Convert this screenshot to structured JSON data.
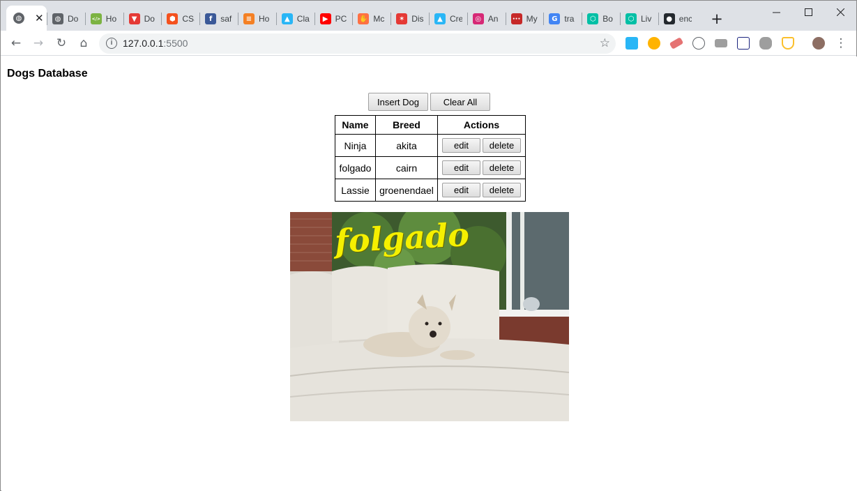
{
  "browser": {
    "tabs": [
      {
        "title": "Do",
        "favicon": "globe-icon",
        "color": "#5f6368"
      },
      {
        "title": "Ho",
        "favicon": "code-icon",
        "color": "#7cb342"
      },
      {
        "title": "Do",
        "favicon": "gitlab-like-icon",
        "color": "#e53935"
      },
      {
        "title": "CSS",
        "favicon": "css-shield-icon",
        "color": "#f4511e"
      },
      {
        "title": "saf",
        "favicon": "facebook-icon",
        "color": "#3b5998"
      },
      {
        "title": "Ho",
        "favicon": "stackoverflow-icon",
        "color": "#f48024"
      },
      {
        "title": "Cla",
        "favicon": "graduation-cap-icon",
        "color": "#29b6f6"
      },
      {
        "title": "PC",
        "favicon": "youtube-icon",
        "color": "#ff0000"
      },
      {
        "title": "Mc",
        "favicon": "hand-icon",
        "color": "#ff7043"
      },
      {
        "title": "Dis",
        "favicon": "figure-icon",
        "color": "#e53935"
      },
      {
        "title": "Cre",
        "favicon": "graduation-cap-icon",
        "color": "#29b6f6"
      },
      {
        "title": "An",
        "favicon": "instagram-icon",
        "color": "#d62976"
      },
      {
        "title": "My",
        "favicon": "dots-icon",
        "color": "#c62828"
      },
      {
        "title": "tra",
        "favicon": "google-icon",
        "color": "#4285f4"
      },
      {
        "title": "Bo",
        "favicon": "hexagon-icon",
        "color": "#00bfa5"
      },
      {
        "title": "Liv",
        "favicon": "hexagon-icon",
        "color": "#00bfa5"
      },
      {
        "title": "enc",
        "favicon": "github-icon",
        "color": "#24292e"
      }
    ],
    "url_host": "127.0.0.1",
    "url_port": ":5500"
  },
  "page": {
    "title": "Dogs Database",
    "insert_label": "Insert Dog",
    "clear_label": "Clear All",
    "table": {
      "headers": [
        "Name",
        "Breed",
        "Actions"
      ],
      "rows": [
        {
          "name": "Ninja",
          "breed": "akita"
        },
        {
          "name": "folgado",
          "breed": "cairn"
        },
        {
          "name": "Lassie",
          "breed": "groenendael"
        }
      ],
      "edit_label": "edit",
      "delete_label": "delete"
    },
    "photo_caption": "folgado"
  }
}
